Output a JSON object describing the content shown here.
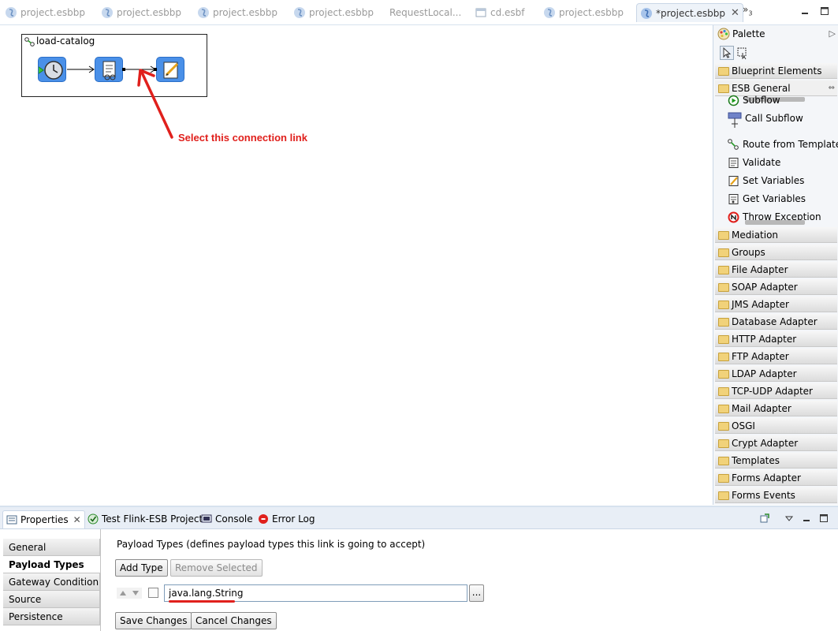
{
  "editor_tabs": [
    {
      "label": "project.esbbp",
      "icon": "esb-file-icon"
    },
    {
      "label": "project.esbbp",
      "icon": "esb-file-icon"
    },
    {
      "label": "project.esbbp",
      "icon": "esb-file-icon"
    },
    {
      "label": "project.esbbp",
      "icon": "esb-file-icon"
    },
    {
      "label": "RequestLocal...",
      "icon": ""
    },
    {
      "label": "cd.esbf",
      "icon": "window-file-icon"
    },
    {
      "label": "project.esbbp",
      "icon": "esb-file-icon"
    },
    {
      "label": "*project.esbbp",
      "icon": "esb-file-icon",
      "active": true
    }
  ],
  "editor_tabs_overflow": "3",
  "canvas": {
    "flow_title": "load-catalog",
    "annotation": "Select this connection link",
    "accent": "#e0201c"
  },
  "palette": {
    "title": "Palette",
    "drawers_top": [
      {
        "label": "Blueprint Elements"
      },
      {
        "label": "ESB General",
        "open": true
      }
    ],
    "items": [
      {
        "label": "Subflow",
        "icon": "subflow-icon"
      },
      {
        "label": "Call Subflow",
        "icon": "call-subflow-icon"
      },
      {
        "label": "Route from Template",
        "icon": "route-icon"
      },
      {
        "label": "Validate",
        "icon": "validate-icon"
      },
      {
        "label": "Set Variables",
        "icon": "set-variables-icon"
      },
      {
        "label": "Get Variables",
        "icon": "get-variables-icon"
      },
      {
        "label": "Throw Exception",
        "icon": "throw-exception-icon"
      }
    ],
    "drawers": [
      "Mediation",
      "Groups",
      "File Adapter",
      "SOAP Adapter",
      "JMS Adapter",
      "Database Adapter",
      "HTTP Adapter",
      "FTP Adapter",
      "LDAP Adapter",
      "TCP-UDP Adapter",
      "Mail Adapter",
      "OSGI",
      "Crypt Adapter",
      "Templates",
      "Forms Adapter",
      "Forms Events"
    ]
  },
  "bottom_tabs": [
    {
      "label": "Properties",
      "icon": "properties-icon",
      "active": true
    },
    {
      "label": "Test Flink-ESB Project",
      "icon": "test-project-icon"
    },
    {
      "label": "Console",
      "icon": "console-icon"
    },
    {
      "label": "Error Log",
      "icon": "error-log-icon"
    }
  ],
  "properties": {
    "sections": [
      "General",
      "Payload Types",
      "Gateway Condition",
      "Source",
      "Persistence"
    ],
    "active_section": "Payload Types",
    "description": "Payload Types (defines payload types this link is going to accept)",
    "add_type": "Add Type",
    "remove_selected": "Remove Selected",
    "type_value": "java.lang.String",
    "browse": "...",
    "save": "Save Changes",
    "cancel": "Cancel Changes"
  }
}
